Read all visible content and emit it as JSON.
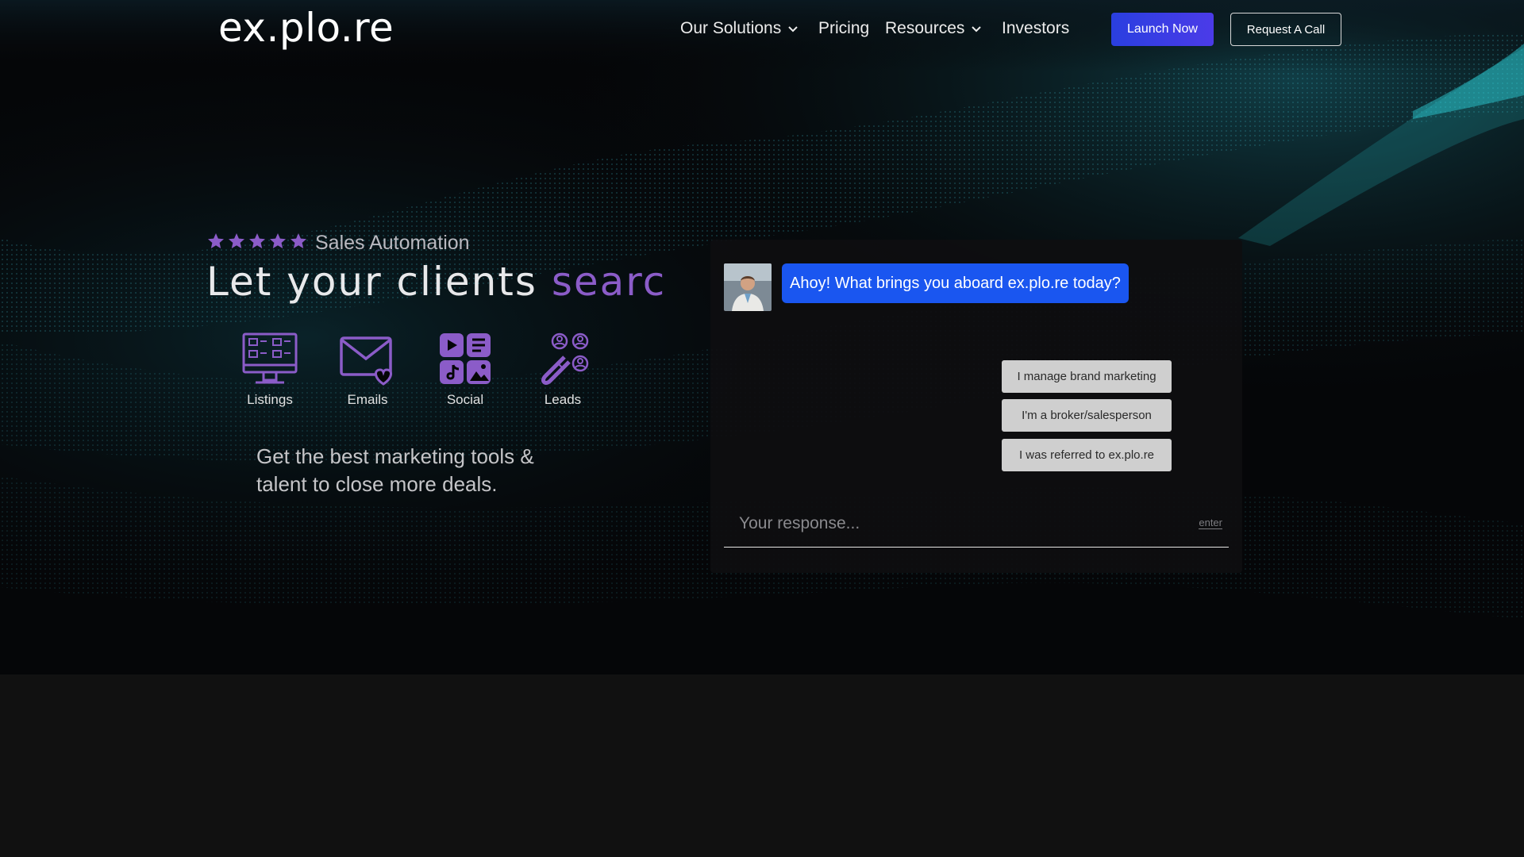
{
  "nav": {
    "logo": "ex.plo.re",
    "items": [
      {
        "label": "Our Solutions",
        "has_dropdown": true
      },
      {
        "label": "Pricing",
        "has_dropdown": false
      },
      {
        "label": "Resources",
        "has_dropdown": true
      },
      {
        "label": "Investors",
        "has_dropdown": false
      }
    ],
    "launch_label": "Launch Now",
    "call_label": "Request A Call"
  },
  "hero": {
    "rating_stars": 5,
    "tagline": "Sales Automation",
    "headline_prefix": "Let your clients ",
    "headline_highlight": "searc",
    "features": [
      {
        "label": "Listings",
        "icon": "listings-monitor-icon"
      },
      {
        "label": "Emails",
        "icon": "email-heart-icon"
      },
      {
        "label": "Social",
        "icon": "social-media-grid-icon"
      },
      {
        "label": "Leads",
        "icon": "lead-magnet-icon"
      }
    ],
    "subcopy": "Get the best marketing tools & talent to close more deals."
  },
  "chat": {
    "bot_message": "Ahoy! What brings you aboard ex.plo.re today?",
    "options": [
      "I manage brand marketing",
      "I'm a broker/salesperson",
      "I was referred to ex.plo.re"
    ],
    "input_placeholder": "Your response...",
    "enter_hint": "enter"
  },
  "colors": {
    "accent_purple": "#8b5cc8",
    "launch_blue": "#2a3fe0",
    "bubble_blue": "#1a56f0",
    "wave_cyan": "#2fd6e0"
  }
}
